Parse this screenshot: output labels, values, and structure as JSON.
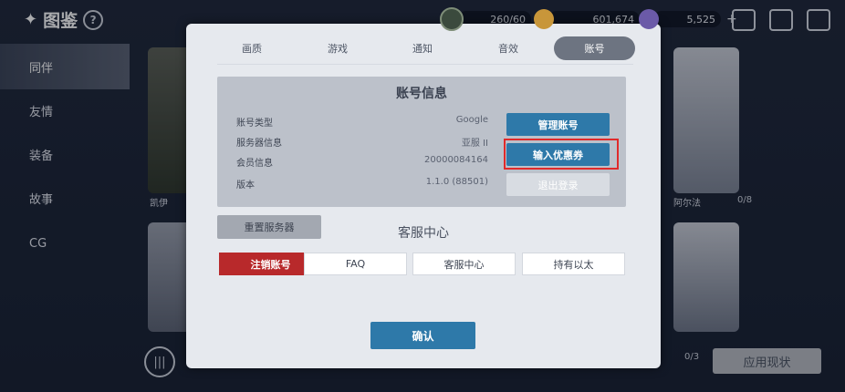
{
  "background": {
    "title": "图鉴",
    "help_icon": "?",
    "resources": [
      {
        "icon": "stamina-icon",
        "value": "260/60"
      },
      {
        "icon": "coin-icon",
        "value": "601,674"
      },
      {
        "icon": "gem-icon",
        "value": "5,525"
      }
    ],
    "sidebar": [
      "同伴",
      "友情",
      "装备",
      "故事",
      "CG"
    ],
    "card_names": [
      "凯伊",
      "阿尔法"
    ],
    "card_counts": [
      "0/8",
      "0/3"
    ],
    "apply_button": "应用现状"
  },
  "modal": {
    "tabs": [
      "画质",
      "游戏",
      "通知",
      "音效",
      "账号"
    ],
    "active_tab": "账号",
    "account_info": {
      "title": "账号信息",
      "rows": [
        {
          "label": "账号类型",
          "value": "Google"
        },
        {
          "label": "服务器信息",
          "value": "亚服 II"
        },
        {
          "label": "会员信息",
          "value": "20000084164"
        },
        {
          "label": "版本",
          "value": "1.1.0 (88501)"
        }
      ],
      "manage_button": "管理账号",
      "coupon_button": "输入优惠券",
      "logout_button": "退出登录"
    },
    "reset_server_button": "重置服务器",
    "customer_service": {
      "title": "客服中心",
      "buttons": [
        "注销账号",
        "FAQ",
        "客服中心",
        "持有以太"
      ]
    },
    "confirm_button": "确认"
  },
  "colors": {
    "accent_blue": "#2e79a9",
    "danger_red": "#b8292b",
    "highlight_red": "#e02a2a"
  }
}
